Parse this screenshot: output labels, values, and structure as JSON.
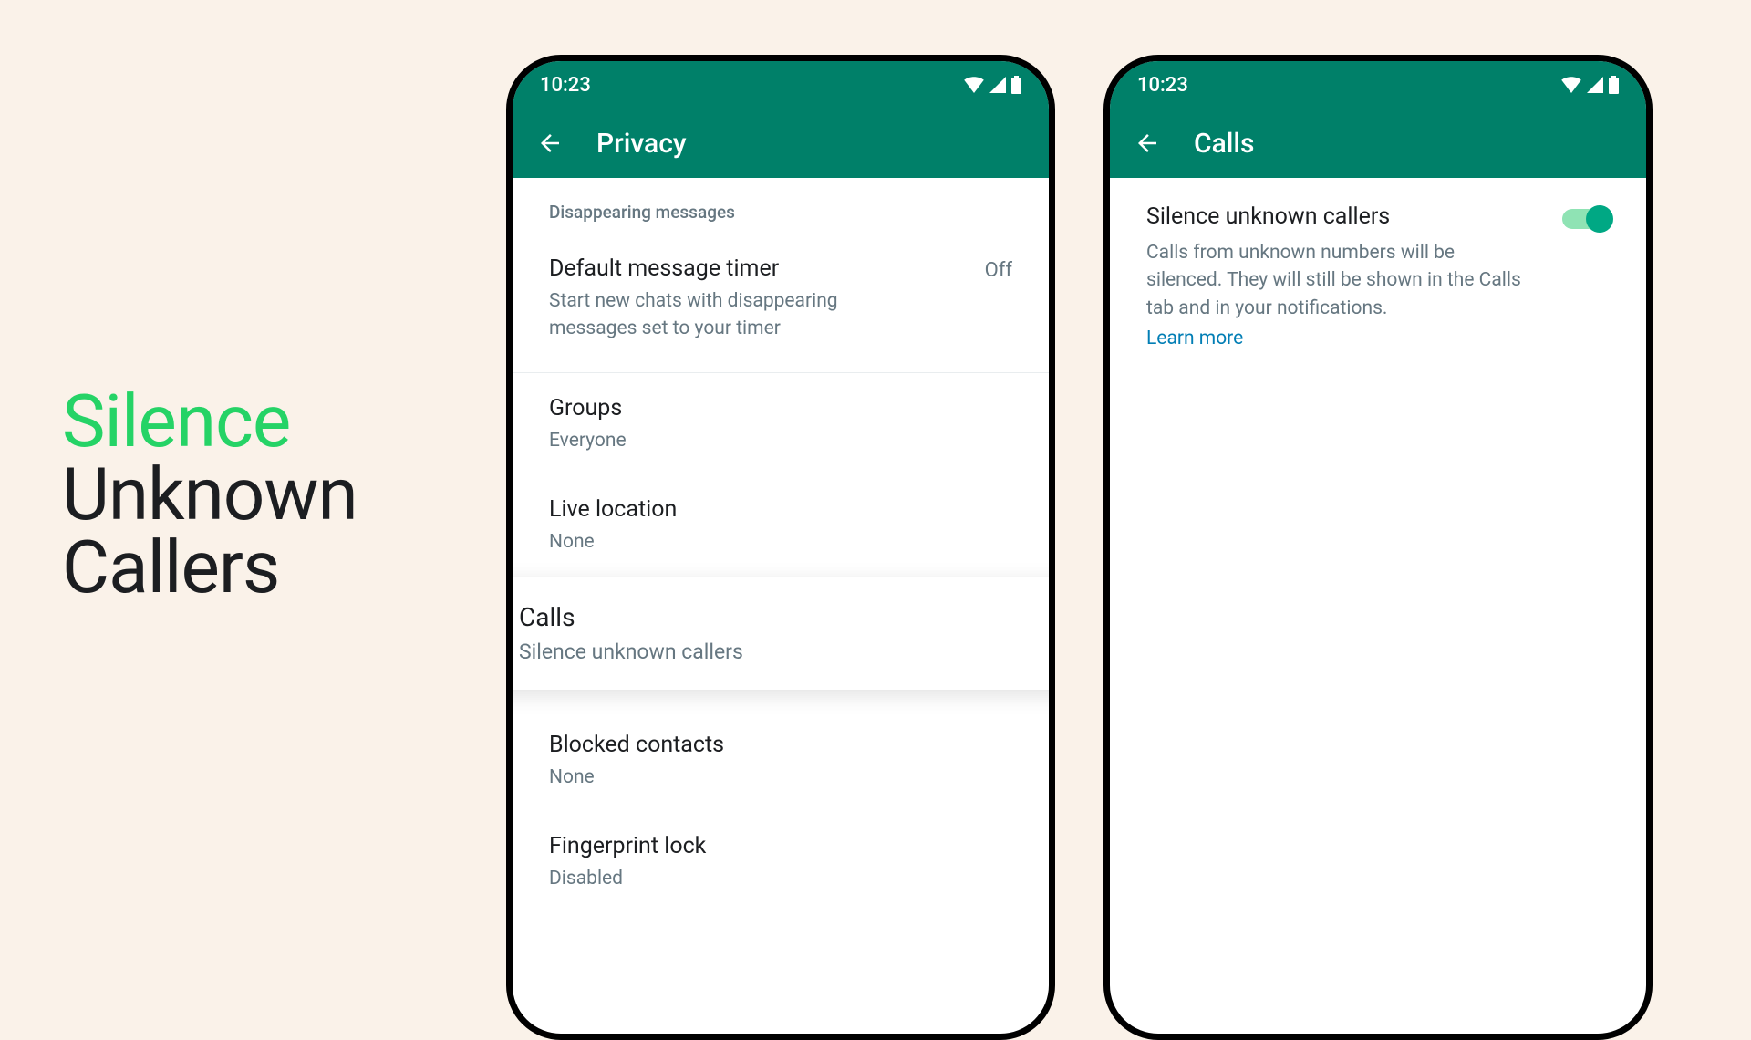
{
  "headline": {
    "line1": "Silence",
    "line2": "Unknown",
    "line3": "Callers"
  },
  "statusTime": "10:23",
  "phoneLeft": {
    "title": "Privacy",
    "sectionHeader": "Disappearing messages",
    "rows": {
      "timer": {
        "title": "Default message timer",
        "subtitle": "Start new chats with disappearing messages set to your timer",
        "value": "Off"
      },
      "groups": {
        "title": "Groups",
        "subtitle": "Everyone"
      },
      "liveLocation": {
        "title": "Live location",
        "subtitle": "None"
      },
      "calls": {
        "title": "Calls",
        "subtitle": "Silence unknown callers"
      },
      "blocked": {
        "title": "Blocked contacts",
        "subtitle": "None"
      },
      "fingerprint": {
        "title": "Fingerprint lock",
        "subtitle": "Disabled"
      }
    }
  },
  "phoneRight": {
    "title": "Calls",
    "setting": {
      "title": "Silence unknown callers",
      "description": "Calls from unknown numbers will be silenced. They will still be shown in the Calls tab and in your notifications.",
      "learnMore": "Learn more",
      "toggleOn": true
    }
  }
}
